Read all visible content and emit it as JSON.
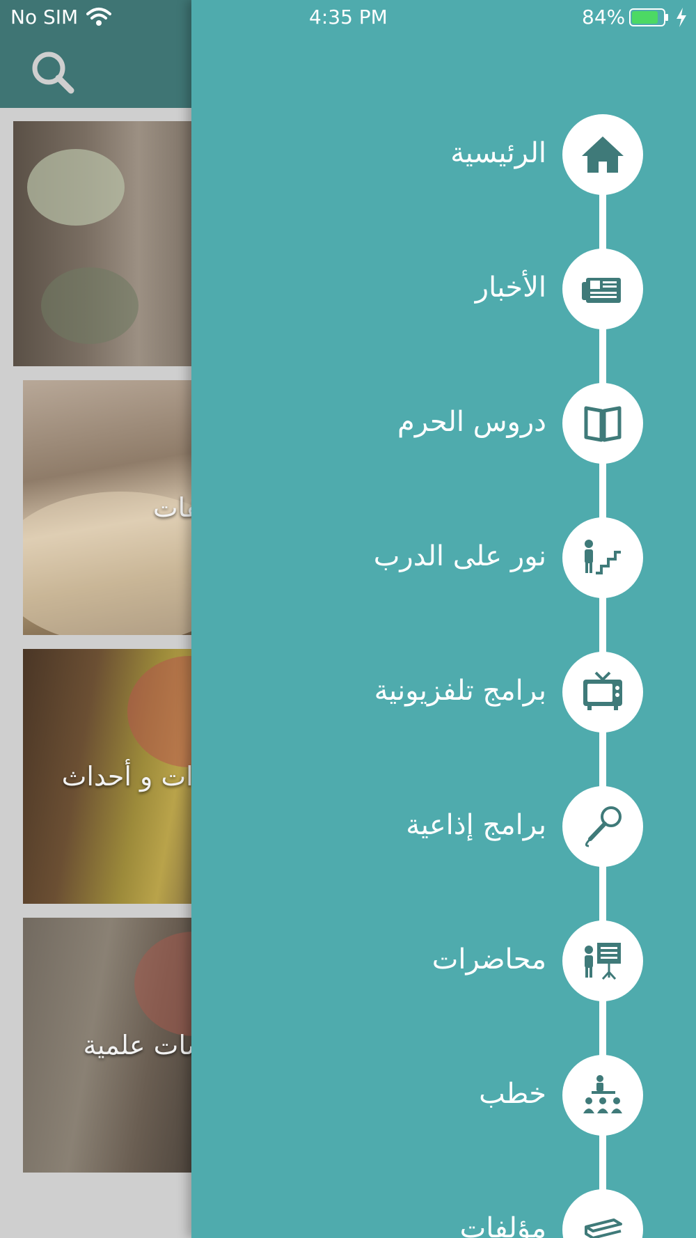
{
  "status_bar": {
    "carrier": "No SIM",
    "time": "4:35 PM",
    "battery_percent": "84%",
    "battery_level": 0.84,
    "charging": true
  },
  "background": {
    "header_color": "#3f7574",
    "search_icon": "search-icon",
    "cards": [
      {
        "title": ""
      },
      {
        "title": "مؤلفات"
      },
      {
        "title": "لقاءات و أحداث"
      },
      {
        "title": "جلسات علمية"
      }
    ]
  },
  "drawer": {
    "background_color": "#4fabad",
    "items": [
      {
        "label": "الرئيسية",
        "icon": "home-icon"
      },
      {
        "label": "الأخبار",
        "icon": "newspaper-icon"
      },
      {
        "label": "دروس الحرم",
        "icon": "book-icon"
      },
      {
        "label": "نور على الدرب",
        "icon": "stairs-person-icon"
      },
      {
        "label": "برامج تلفزيونية",
        "icon": "tv-icon"
      },
      {
        "label": "برامج إذاعية",
        "icon": "microphone-icon"
      },
      {
        "label": "محاضرات",
        "icon": "presenter-icon"
      },
      {
        "label": "خطب",
        "icon": "speaker-audience-icon"
      },
      {
        "label": "مؤلفات",
        "icon": "books-icon"
      }
    ]
  }
}
